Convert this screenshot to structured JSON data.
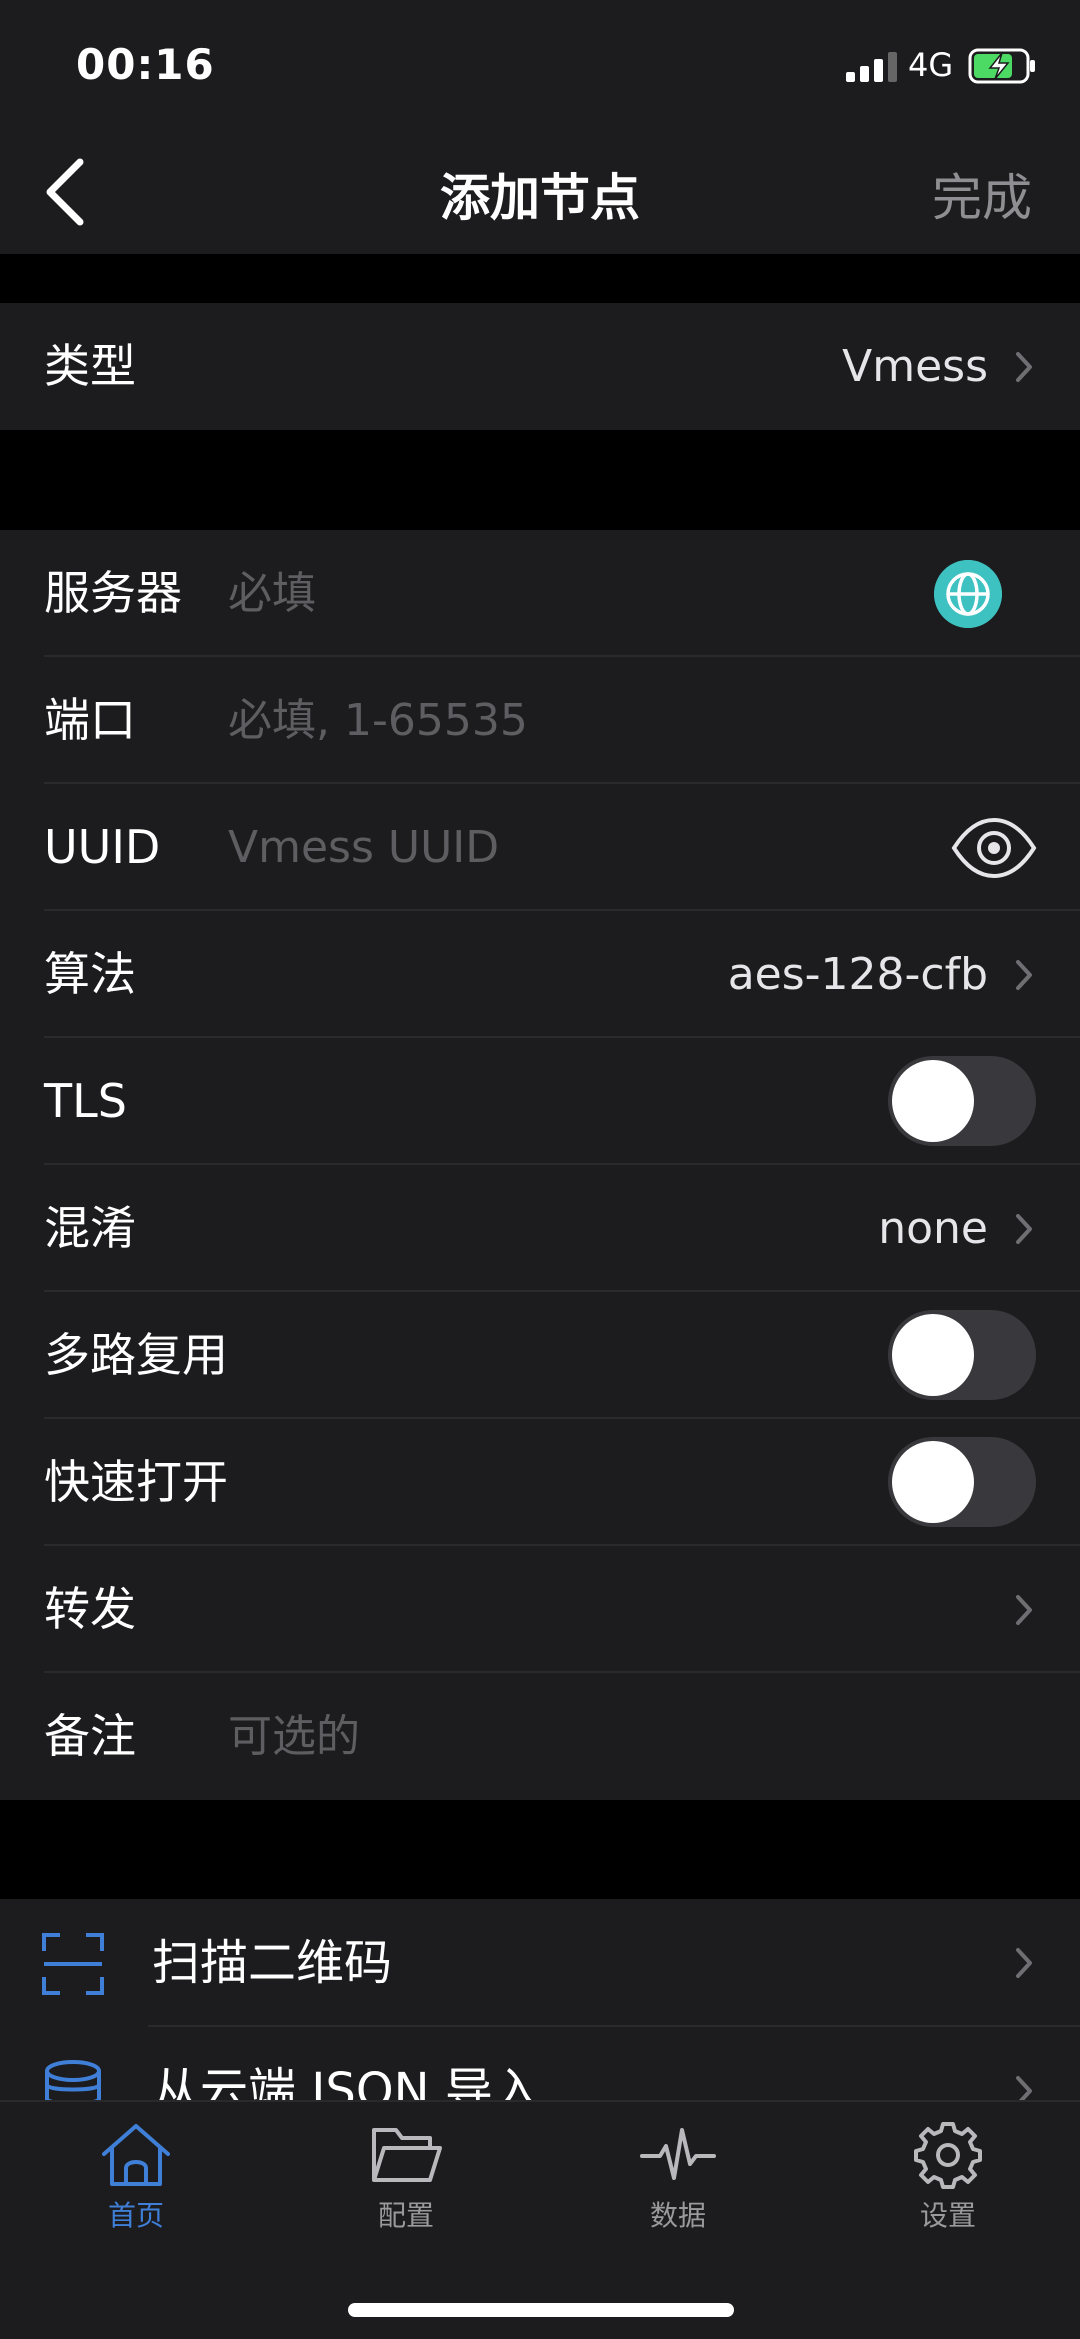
{
  "status_bar": {
    "time": "00:16",
    "network": "4G"
  },
  "nav": {
    "title": "添加节点",
    "done_label": "完成"
  },
  "type_row": {
    "label": "类型",
    "value": "Vmess"
  },
  "form": {
    "server": {
      "label": "服务器",
      "placeholder": "必填"
    },
    "port": {
      "label": "端口",
      "placeholder": "必填, 1-65535"
    },
    "uuid": {
      "label": "UUID",
      "placeholder": "Vmess UUID"
    },
    "algorithm": {
      "label": "算法",
      "value": "aes-128-cfb"
    },
    "tls": {
      "label": "TLS",
      "enabled": false
    },
    "obfs": {
      "label": "混淆",
      "value": "none"
    },
    "mux": {
      "label": "多路复用",
      "enabled": false
    },
    "fast_open": {
      "label": "快速打开",
      "enabled": false
    },
    "forward": {
      "label": "转发"
    },
    "remark": {
      "label": "备注",
      "placeholder": "可选的"
    }
  },
  "import": {
    "scan_qr": {
      "label": "扫描二维码",
      "icon": "qr-scan-icon"
    },
    "cloud_json": {
      "label": "从云端 JSON 导入",
      "icon": "database-icon"
    }
  },
  "tabbar": {
    "tabs": [
      {
        "label": "首页",
        "icon": "home-icon",
        "active": true
      },
      {
        "label": "配置",
        "icon": "folder-icon",
        "active": false
      },
      {
        "label": "数据",
        "icon": "activity-icon",
        "active": false
      },
      {
        "label": "设置",
        "icon": "gear-icon",
        "active": false
      }
    ]
  },
  "colors": {
    "accent": "#3f7fd8",
    "globe": "#3ec1c1",
    "background": "#000000",
    "surface": "#1c1c1e"
  }
}
